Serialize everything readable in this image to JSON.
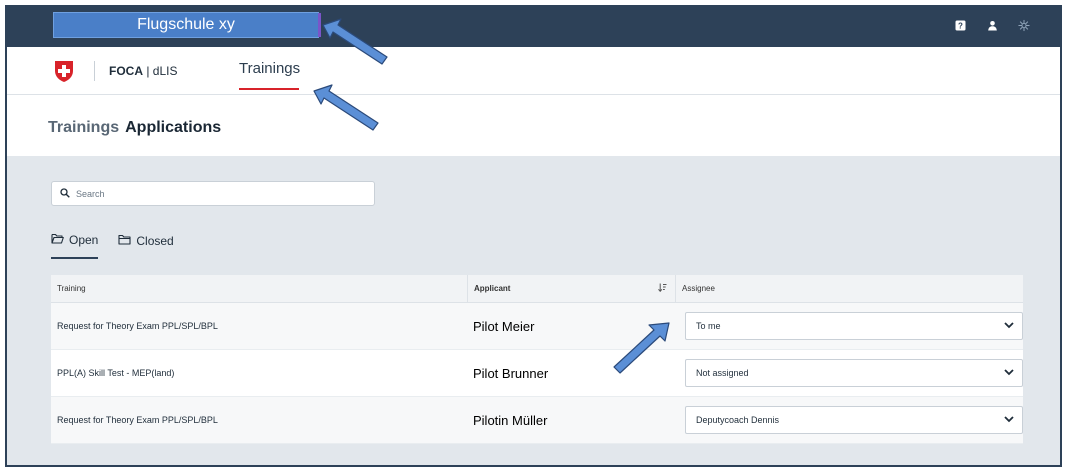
{
  "topbar": {
    "org_label": "Flugschule xy",
    "icons": [
      "help-icon",
      "user-icon",
      "theme-icon"
    ]
  },
  "navbar": {
    "brand_bold": "FOCA",
    "brand_rest": " | dLIS",
    "active_tab": "Trainings"
  },
  "header": {
    "crumb_parent": "Trainings",
    "crumb_current": "Applications"
  },
  "search": {
    "placeholder": "Search"
  },
  "tabs": [
    {
      "label": "Open",
      "active": true
    },
    {
      "label": "Closed",
      "active": false
    }
  ],
  "table": {
    "columns": {
      "training": "Training",
      "applicant": "Applicant",
      "assignee": "Assignee"
    },
    "rows": [
      {
        "training": "Request for Theory Exam PPL/SPL/BPL",
        "applicant": "Pilot Meier",
        "assignee": "To me"
      },
      {
        "training": "PPL(A) Skill Test - MEP(land)",
        "applicant": "Pilot Brunner",
        "assignee": "Not assigned"
      },
      {
        "training": "Request for Theory Exam PPL/SPL/BPL",
        "applicant": "Pilotin Müller",
        "assignee": "Deputycoach Dennis"
      }
    ]
  },
  "colors": {
    "topbar": "#2d4158",
    "accent_red": "#d8232a",
    "annotation_arrow": "#5b8fd6"
  }
}
